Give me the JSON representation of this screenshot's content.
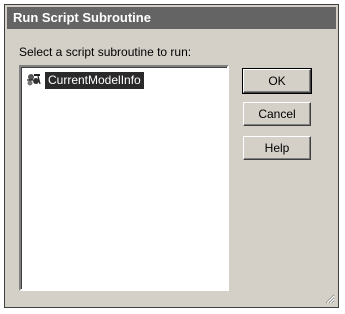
{
  "dialog": {
    "title": "Run Script Subroutine",
    "prompt": "Select a script subroutine to run:"
  },
  "list": {
    "items": [
      {
        "label": "CurrentModelInfo",
        "icon": "script-subroutine-icon",
        "selected": true
      }
    ]
  },
  "buttons": {
    "ok": "OK",
    "cancel": "Cancel",
    "help": "Help"
  }
}
